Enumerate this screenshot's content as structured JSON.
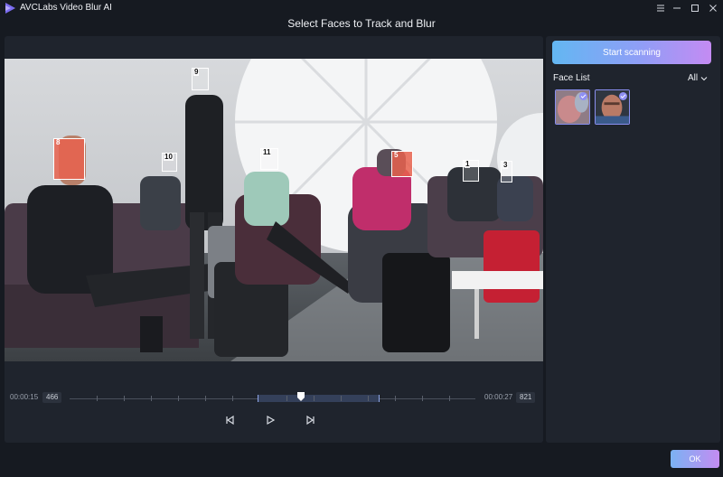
{
  "app": {
    "title": "AVCLabs Video Blur AI"
  },
  "dialog": {
    "title": "Select Faces to Track and Blur"
  },
  "faces": [
    {
      "label": "9",
      "selected": false
    },
    {
      "label": "8",
      "selected": true
    },
    {
      "label": "10",
      "selected": false
    },
    {
      "label": "11",
      "selected": false
    },
    {
      "label": "5",
      "selected": true
    },
    {
      "label": "1",
      "selected": false
    },
    {
      "label": "3",
      "selected": false
    }
  ],
  "timeline": {
    "start_time": "00:00:15",
    "start_frame": "466",
    "end_time": "00:00:27",
    "end_frame": "821"
  },
  "side": {
    "scan_label": "Start scanning",
    "face_list_label": "Face List",
    "filter_value": "All"
  },
  "footer": {
    "ok_label": "OK"
  },
  "colors": {
    "accent_start": "#63b7f2",
    "accent_end": "#c48bf3",
    "selected_face": "#e8624e",
    "panel": "#1f242d",
    "background": "#161a21"
  }
}
